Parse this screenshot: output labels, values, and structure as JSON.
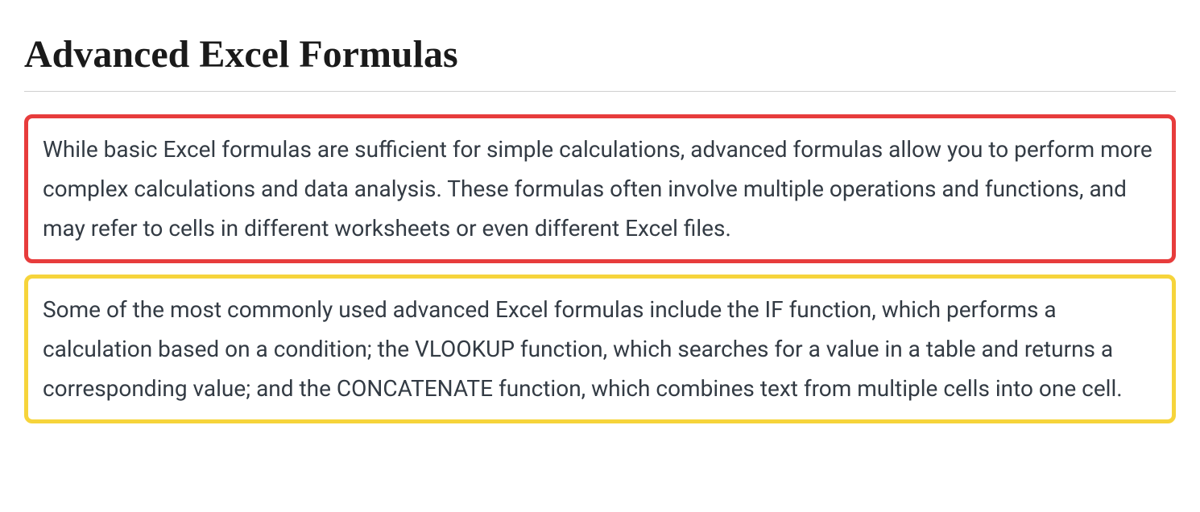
{
  "title": "Advanced Excel Formulas",
  "paragraphs": {
    "p1": "While basic Excel formulas are sufficient for simple calculations, advanced formulas allow you to perform more complex calculations and data analysis. These formulas often involve multiple operations and functions, and may refer to cells in different worksheets or even different Excel files.",
    "p2": "Some of the most commonly used advanced Excel formulas include the IF function, which performs a calculation based on a condition; the VLOOKUP function, which searches for a value in a table and returns a corresponding value; and the CONCATENATE function, which combines text from multiple cells into one cell."
  }
}
